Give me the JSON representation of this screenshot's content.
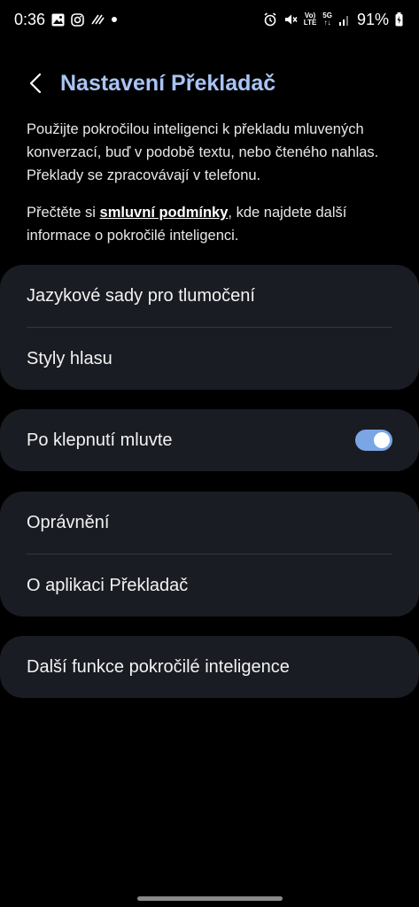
{
  "status_bar": {
    "time": "0:36",
    "network_top": "Vo)",
    "network_bottom": "LTE",
    "gen_top": "5G",
    "gen_bottom": "↑↓",
    "battery": "91%"
  },
  "header": {
    "title": "Nastavení Překladač"
  },
  "description": {
    "paragraph1": "Použijte pokročilou inteligenci k překladu mluvených konverzací, buď v podobě textu, nebo čteného nahlas. Překlady se zpracovávají v telefonu.",
    "paragraph2_prefix": "Přečtěte si ",
    "paragraph2_link": "smluvní podmínky",
    "paragraph2_suffix": ", kde najdete další informace o pokročilé inteligenci."
  },
  "settings": {
    "group1": {
      "language_packs": "Jazykové sady pro tlumočení",
      "voice_styles": "Styly hlasu"
    },
    "group2": {
      "tap_to_speak": "Po klepnutí mluvte",
      "tap_to_speak_enabled": true
    },
    "group3": {
      "permissions": "Oprávnění",
      "about": "O aplikaci Překladač"
    },
    "group4": {
      "more_features": "Další funkce pokročilé inteligence"
    }
  },
  "colors": {
    "accent": "#a9c4f5",
    "toggle_on": "#7aa6e6",
    "card_bg": "#1a1c23"
  }
}
